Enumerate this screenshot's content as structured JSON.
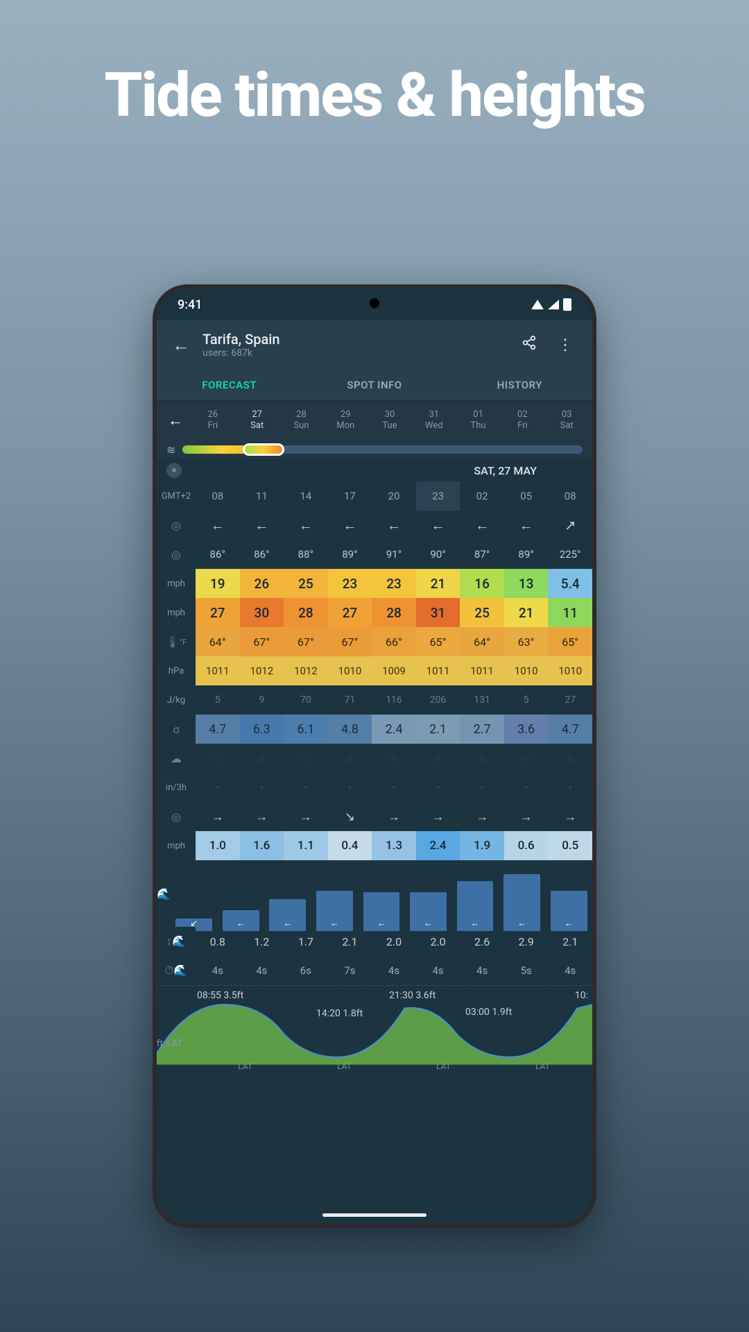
{
  "headline": "Tide times & heights",
  "status": {
    "time": "9:41"
  },
  "header": {
    "location": "Tarifa, Spain",
    "sub": "users: 687k"
  },
  "tabs": {
    "forecast": "FORECAST",
    "spot": "SPOT INFO",
    "history": "HISTORY"
  },
  "dates": [
    {
      "d": "26",
      "w": "Fri"
    },
    {
      "d": "27",
      "w": "Sat"
    },
    {
      "d": "28",
      "w": "Sun"
    },
    {
      "d": "29",
      "w": "Mon"
    },
    {
      "d": "30",
      "w": "Tue"
    },
    {
      "d": "31",
      "w": "Wed"
    },
    {
      "d": "01",
      "w": "Thu"
    },
    {
      "d": "02",
      "w": "Fri"
    },
    {
      "d": "03",
      "w": "Sat"
    }
  ],
  "slider": {
    "fill_pct": 24,
    "thumb_left_pct": 15
  },
  "date_label": "SAT, 27 MAY",
  "tz": "GMT+2",
  "hours": [
    "08",
    "11",
    "14",
    "17",
    "20",
    "23",
    "02",
    "05",
    "08"
  ],
  "rows": {
    "dir_arrows": [
      "←",
      "←",
      "←",
      "←",
      "←",
      "←",
      "←",
      "←",
      "↗"
    ],
    "deg": [
      "86°",
      "86°",
      "88°",
      "89°",
      "91°",
      "90°",
      "87°",
      "89°",
      "225°"
    ],
    "wind1": {
      "label": "mph",
      "vals": [
        "19",
        "26",
        "25",
        "23",
        "23",
        "21",
        "16",
        "13",
        "5.4"
      ],
      "bg": [
        "#ead94a",
        "#f2b439",
        "#f2b439",
        "#f4c43c",
        "#f4c43c",
        "#efd548",
        "#b1dc4e",
        "#8fd95c",
        "#7fbfe8"
      ]
    },
    "wind2": {
      "label": "mph",
      "vals": [
        "27",
        "30",
        "28",
        "27",
        "28",
        "31",
        "25",
        "21",
        "11"
      ],
      "bg": [
        "#f0a236",
        "#e87a2e",
        "#ee9232",
        "#f0a236",
        "#ee9232",
        "#e46c2c",
        "#f3c13c",
        "#eed94a",
        "#8ed75d"
      ]
    },
    "temp": {
      "label": "°F",
      "vals": [
        "64°",
        "67°",
        "67°",
        "67°",
        "66°",
        "65°",
        "64°",
        "63°",
        "65°"
      ],
      "bg": [
        "#e9a63e",
        "#ea9c38",
        "#ea9c38",
        "#ea9c38",
        "#eaa23a",
        "#eaa83e",
        "#e9a63e",
        "#e9ac42",
        "#eaa23a"
      ]
    },
    "hpa": {
      "label": "hPa",
      "vals": [
        "1011",
        "1012",
        "1012",
        "1010",
        "1009",
        "1011",
        "1011",
        "1010",
        "1010"
      ],
      "bg": [
        "#e7c24e",
        "#e7c24e",
        "#e7c24e",
        "#e7c24e",
        "#e7c24e",
        "#e7c24e",
        "#e7c24e",
        "#e7c24e",
        "#e7c24e"
      ]
    },
    "jkg": {
      "label": "J/kg",
      "vals": [
        "5",
        "9",
        "70",
        "71",
        "116",
        "206",
        "131",
        "5",
        "27"
      ]
    },
    "sigma": {
      "label": "σ",
      "vals": [
        "4.7",
        "6.3",
        "6.1",
        "4.8",
        "2.4",
        "2.1",
        "2.7",
        "3.6",
        "4.7"
      ],
      "bg": [
        "#567fa8",
        "#477aac",
        "#4b7dad",
        "#557ea8",
        "#7999b4",
        "#7c9bb5",
        "#7395b2",
        "#647fac",
        "#567fa8"
      ]
    },
    "precip": {
      "label": "in/3h",
      "drops": [
        "◌",
        "◌",
        "◌",
        "◌",
        "◌",
        "◌",
        "◌",
        "◌",
        "◌"
      ],
      "vals": [
        "-",
        "-",
        "-",
        "-",
        "-",
        "-",
        "-",
        "-",
        "-"
      ]
    },
    "swdir": [
      "→",
      "→",
      "→",
      "↘",
      "→",
      "→",
      "→",
      "→",
      "→"
    ],
    "swell": {
      "label": "mph",
      "vals": [
        "1.0",
        "1.6",
        "1.1",
        "0.4",
        "1.3",
        "2.4",
        "1.9",
        "0.6",
        "0.5"
      ],
      "bg": [
        "#a4cbe6",
        "#8bbfe3",
        "#9ec8e5",
        "#c5dbe8",
        "#96c3e4",
        "#59a8e4",
        "#75b5e3",
        "#b7d4e7",
        "#bed8e8"
      ]
    },
    "bars": {
      "heights": [
        18,
        30,
        46,
        58,
        56,
        56,
        72,
        82,
        58
      ],
      "ar": [
        "↙",
        "←",
        "←",
        "←",
        "←",
        "←",
        "←",
        "←",
        "←"
      ]
    },
    "waveh": {
      "vals": [
        "0.8",
        "1.2",
        "1.7",
        "2.1",
        "2.0",
        "2.0",
        "2.6",
        "2.9",
        "2.1"
      ]
    },
    "wavep": {
      "vals": [
        "4s",
        "4s",
        "6s",
        "7s",
        "4s",
        "4s",
        "4s",
        "5s",
        "4s"
      ]
    }
  },
  "tide": {
    "labels": {
      "t1": "08:55 3.5ft",
      "t2": "14:20 1.8ft",
      "t3": "21:30 3.6ft",
      "t4": "03:00 1.9ft",
      "t5": "10:"
    },
    "unit": "ft, LAT",
    "ticks": [
      "LAT",
      "LAT",
      "LAT",
      "LAT"
    ]
  }
}
